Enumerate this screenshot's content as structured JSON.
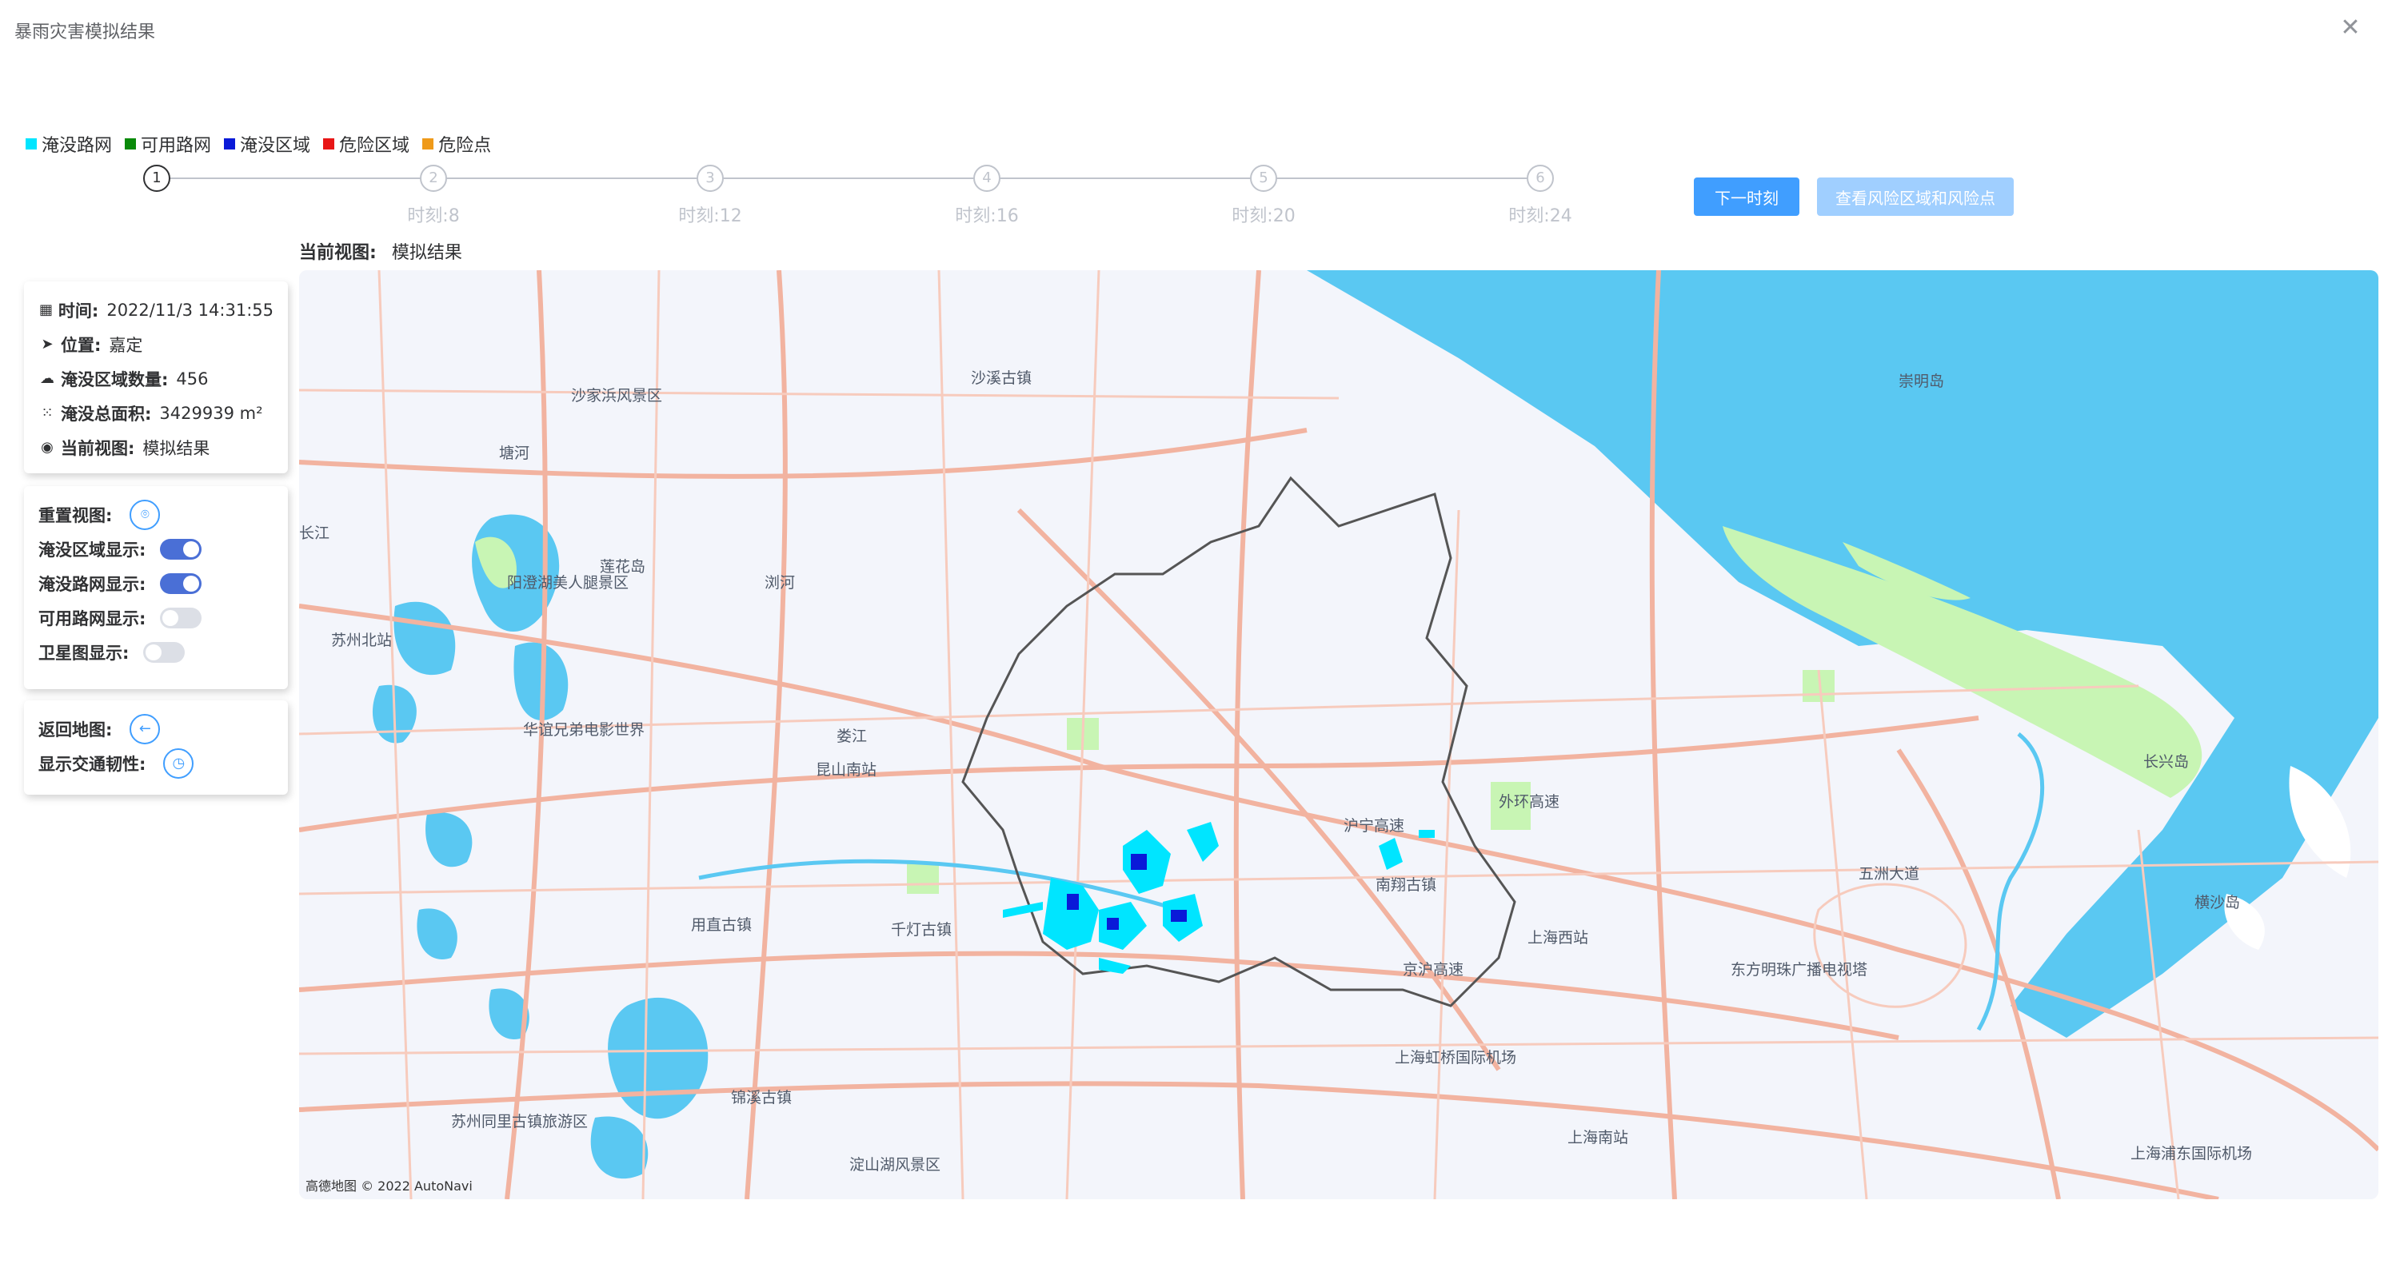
{
  "dialog": {
    "title": "暴雨灾害模拟结果",
    "close_icon": "close-icon"
  },
  "legend": [
    {
      "label": "淹没路网",
      "color": "#00e5ff"
    },
    {
      "label": "可用路网",
      "color": "#0a8a0a"
    },
    {
      "label": "淹没区域",
      "color": "#0a1ad8"
    },
    {
      "label": "危险区域",
      "color": "#e81616"
    },
    {
      "label": "危险点",
      "color": "#ef9a1a"
    }
  ],
  "steps": [
    {
      "num": "1",
      "label": ""
    },
    {
      "num": "2",
      "label": "时刻:8"
    },
    {
      "num": "3",
      "label": "时刻:12"
    },
    {
      "num": "4",
      "label": "时刻:16"
    },
    {
      "num": "5",
      "label": "时刻:20"
    },
    {
      "num": "6",
      "label": "时刻:24"
    }
  ],
  "buttons": {
    "next": "下一时刻",
    "view_risk": "查看风险区域和风险点"
  },
  "current_view": {
    "label": "当前视图:",
    "value": "模拟结果"
  },
  "info": {
    "time": {
      "label": "时间:",
      "value": "2022/11/3 14:31:55",
      "icon": "calendar-icon"
    },
    "location": {
      "label": "位置:",
      "value": "嘉定",
      "icon": "location-arrow-icon"
    },
    "count": {
      "label": "淹没区域数量:",
      "value": "456",
      "icon": "cloud-icon"
    },
    "area": {
      "label": "淹没总面积:",
      "value": "3429939 m²",
      "icon": "grid-icon"
    },
    "view": {
      "label": "当前视图:",
      "value": "模拟结果",
      "icon": "eye-icon"
    }
  },
  "controls": {
    "reset_view": "重置视图:",
    "flood_area_display": {
      "label": "淹没区域显示:",
      "on": true
    },
    "flood_road_display": {
      "label": "淹没路网显示:",
      "on": true
    },
    "usable_road_display": {
      "label": "可用路网显示:",
      "on": false
    },
    "satellite_display": {
      "label": "卫星图显示:",
      "on": false
    }
  },
  "nav": {
    "back_to_map": "返回地图:",
    "show_resilience": "显示交通韧性:"
  },
  "map": {
    "attribution": "高德地图 © 2022 AutoNavi",
    "labels": [
      "沙溪古镇",
      "沙家浜风景区",
      "崇明岛",
      "塘河",
      "长江",
      "阳澄湖美人腿景区",
      "莲花岛",
      "浏河",
      "苏州北站",
      "娄江",
      "昆山南站",
      "华谊兄弟电影世界",
      "南翔古镇",
      "上海西站",
      "东方明珠广播电视塔",
      "用直古镇",
      "千灯古镇",
      "上海虹桥国际机场",
      "锦溪古镇",
      "上海南站",
      "苏州同里古镇旅游区",
      "淀山湖风景区",
      "上海浦东国际机场",
      "长兴岛",
      "横沙岛",
      "五洲大道",
      "沪宁高速",
      "京沪高速",
      "外环高速"
    ]
  }
}
